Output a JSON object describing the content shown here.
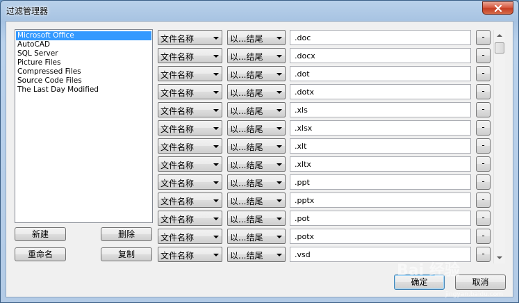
{
  "window": {
    "title": "过滤管理器",
    "close_symbol": "✕"
  },
  "filter_sets": [
    {
      "label": "Microsoft Office",
      "selected": true
    },
    {
      "label": "AutoCAD",
      "selected": false
    },
    {
      "label": "SQL Server",
      "selected": false
    },
    {
      "label": "Picture Files",
      "selected": false
    },
    {
      "label": "Compressed Files",
      "selected": false
    },
    {
      "label": "Source Code Files",
      "selected": false
    },
    {
      "label": "The Last Day Modified",
      "selected": false
    }
  ],
  "set_buttons": {
    "new": "新建",
    "delete": "删除",
    "rename": "重命名",
    "copy": "复制"
  },
  "rules": [
    {
      "field": "文件名称",
      "operator": "以...结尾",
      "value": ".doc",
      "remove": "-"
    },
    {
      "field": "文件名称",
      "operator": "以...结尾",
      "value": ".docx",
      "remove": "-"
    },
    {
      "field": "文件名称",
      "operator": "以...结尾",
      "value": ".dot",
      "remove": "-"
    },
    {
      "field": "文件名称",
      "operator": "以...结尾",
      "value": ".dotx",
      "remove": "-"
    },
    {
      "field": "文件名称",
      "operator": "以...结尾",
      "value": ".xls",
      "remove": "-"
    },
    {
      "field": "文件名称",
      "operator": "以...结尾",
      "value": ".xlsx",
      "remove": "-"
    },
    {
      "field": "文件名称",
      "operator": "以...结尾",
      "value": ".xlt",
      "remove": "-"
    },
    {
      "field": "文件名称",
      "operator": "以...结尾",
      "value": ".xltx",
      "remove": "-"
    },
    {
      "field": "文件名称",
      "operator": "以...结尾",
      "value": ".ppt",
      "remove": "-"
    },
    {
      "field": "文件名称",
      "operator": "以...结尾",
      "value": ".pptx",
      "remove": "-"
    },
    {
      "field": "文件名称",
      "operator": "以...结尾",
      "value": ".pot",
      "remove": "-"
    },
    {
      "field": "文件名称",
      "operator": "以...结尾",
      "value": ".potx",
      "remove": "-"
    },
    {
      "field": "文件名称",
      "operator": "以...结尾",
      "value": ".vsd",
      "remove": "-"
    }
  ],
  "dialog_buttons": {
    "ok": "确定",
    "cancel": "取消"
  },
  "watermark": {
    "brand": "Bai 经验",
    "url": "jingyan.baidu.com"
  }
}
